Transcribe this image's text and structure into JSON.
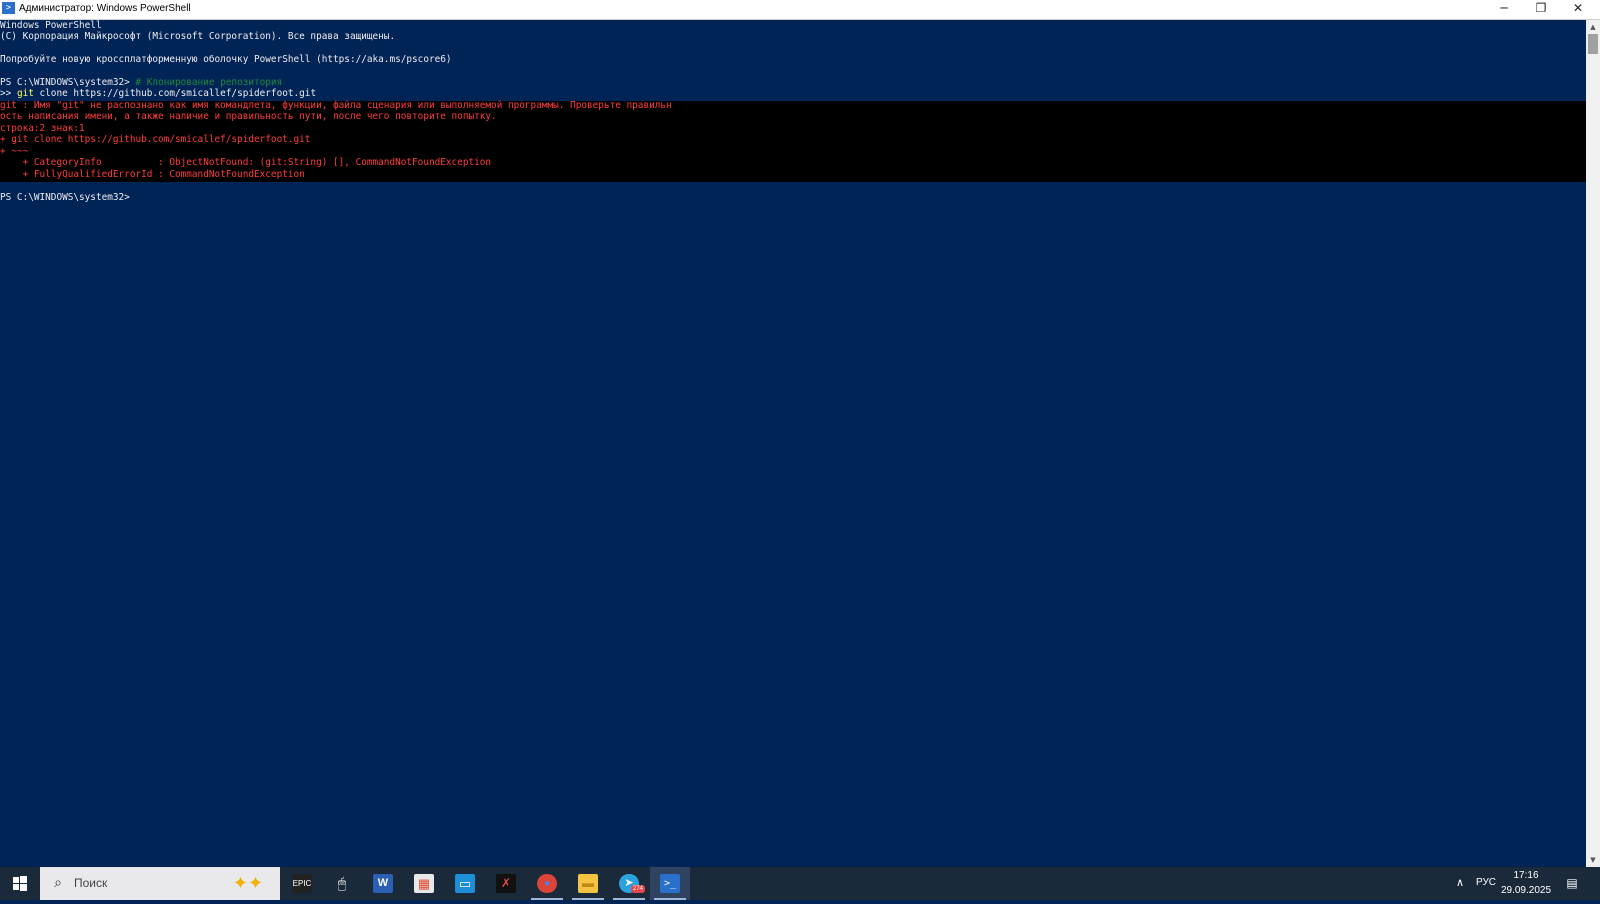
{
  "window": {
    "title": "Администратор: Windows PowerShell",
    "minimize_glyph": "─",
    "maximize_glyph": "❐",
    "close_glyph": "✕"
  },
  "console": {
    "line_header": "Windows PowerShell",
    "line_copyright": "(C) Корпорация Майкрософт (Microsoft Corporation). Все права защищены.",
    "line_pscore": "Попробуйте новую кроссплатформенную оболочку PowerShell (https://aka.ms/pscore6)",
    "prompt1": "PS C:\\WINDOWS\\system32> ",
    "comment": "# Клонирование репозитория",
    "continuation": ">> ",
    "cmd_git": "git",
    "cmd_rest": " clone https://github.com/smicallef/spiderfoot.git",
    "err1": "git : Имя \"git\" не распознано как имя командлета, функции, файла сценария или выполняемой программы. Проверьте правильн",
    "err2": "ость написания имени, а также наличие и правильность пути, после чего повторите попытку.",
    "err3": "строка:2 знак:1",
    "err4": "+ git clone https://github.com/smicallef/spiderfoot.git",
    "err5": "+ ~~~",
    "err6": "    + CategoryInfo          : ObjectNotFound: (git:String) [], CommandNotFoundException",
    "err7": "    + FullyQualifiedErrorId : CommandNotFoundException",
    "prompt2": "PS C:\\WINDOWS\\system32>"
  },
  "taskbar": {
    "search_placeholder": "Поиск",
    "apps": [
      {
        "name": "Epic Games Launcher",
        "label": "EPIC"
      },
      {
        "name": "Mouse app",
        "label": "🖱"
      },
      {
        "name": "Word",
        "label": "W"
      },
      {
        "name": "Microsoft Store",
        "label": "▦"
      },
      {
        "name": "Remote Desktop",
        "label": "▭"
      },
      {
        "name": "Terminal app",
        "label": "✗"
      },
      {
        "name": "Google Chrome",
        "label": "●"
      },
      {
        "name": "File Explorer",
        "label": "▬"
      },
      {
        "name": "Telegram",
        "label": "➤",
        "badge": "274"
      },
      {
        "name": "Windows PowerShell",
        "label": ">_"
      }
    ],
    "tray": {
      "language": "РУС",
      "time": "17:16",
      "date": "29.09.2025"
    }
  },
  "colors": {
    "console_bg": "#012456",
    "error_bg": "#000000",
    "error_text": "#ff3c3c",
    "comment_text": "#1f8a3b",
    "command_text": "#ffff60"
  }
}
